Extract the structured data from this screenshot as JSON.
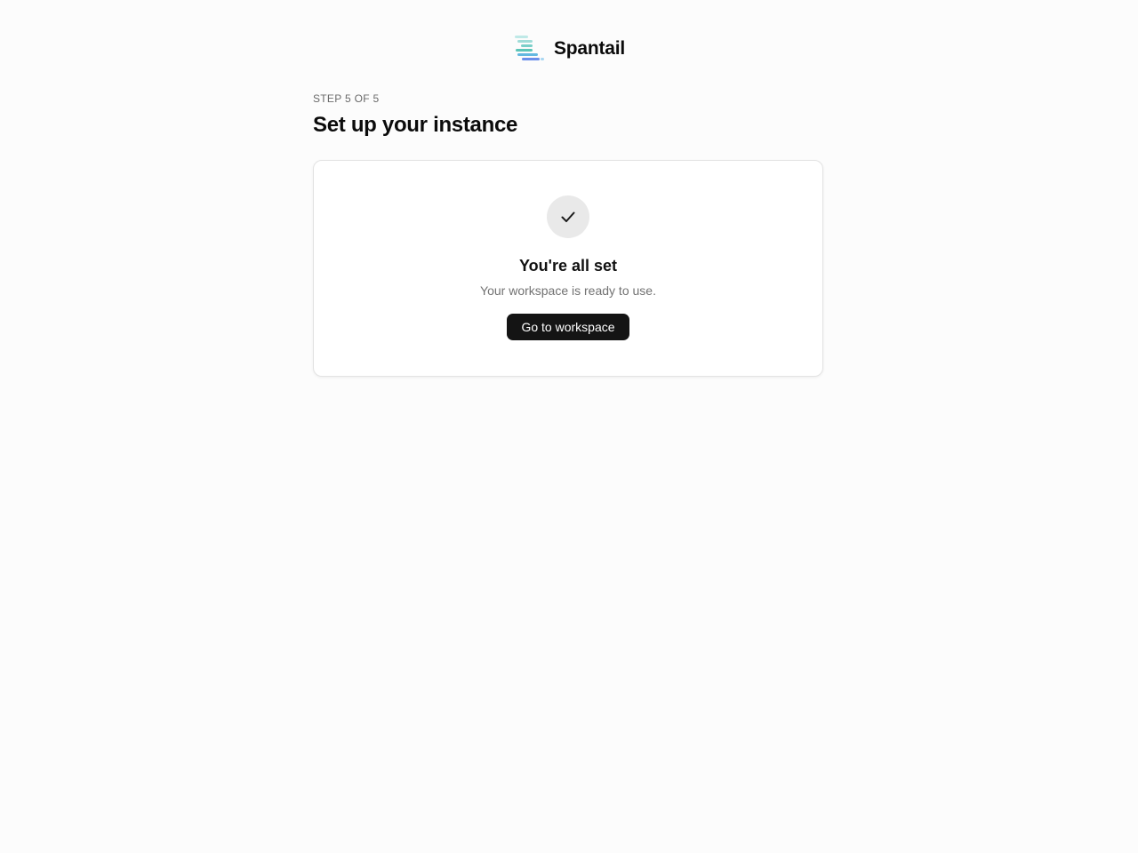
{
  "header": {
    "brand_name": "Spantail",
    "logo_icon": "spantail-logo-icon"
  },
  "setup": {
    "step_label": "STEP 5 OF 5",
    "title": "Set up your instance"
  },
  "completion_card": {
    "icon": "checkmark-icon",
    "title": "You're all set",
    "subtitle": "Your workspace is ready to use.",
    "button_label": "Go to workspace"
  },
  "colors": {
    "background": "#fcfcfc",
    "button": "#141414",
    "icon_circle": "#e9e9e9"
  }
}
